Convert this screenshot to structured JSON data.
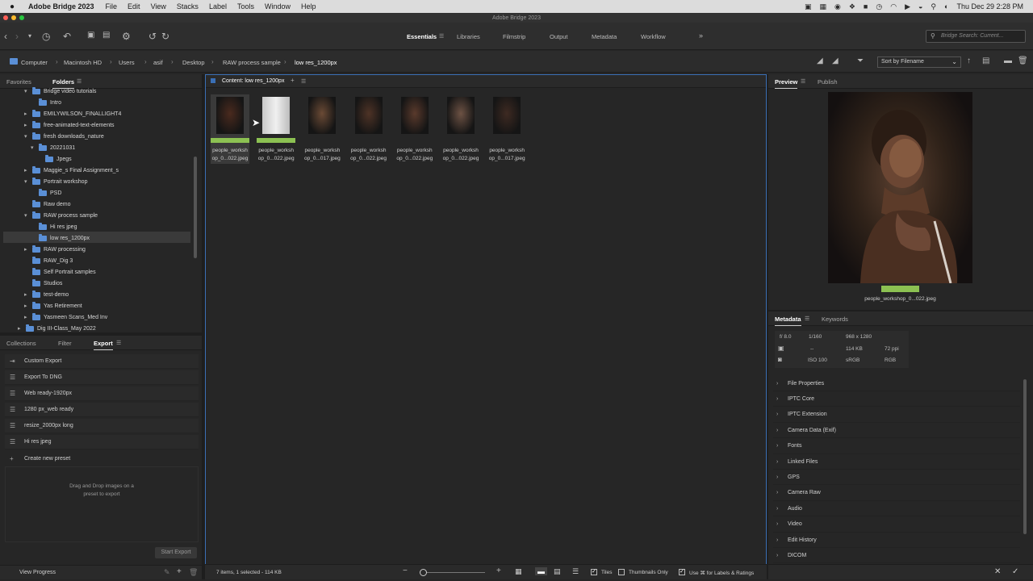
{
  "menubar": {
    "apple": "",
    "app": "Adobe Bridge 2023",
    "items": [
      "File",
      "Edit",
      "View",
      "Stacks",
      "Label",
      "Tools",
      "Window",
      "Help"
    ],
    "clock": "Thu Dec 29  2:28 PM"
  },
  "window": {
    "title": "Adobe Bridge 2023"
  },
  "workspaces": [
    "Essentials",
    "Libraries",
    "Filmstrip",
    "Output",
    "Metadata",
    "Workflow"
  ],
  "search": {
    "placeholder": "Bridge Search: Current..."
  },
  "breadcrumb": [
    "Computer",
    "Macintosh HD",
    "Users",
    "asif",
    "Desktop",
    "RAW process sample",
    "low res_1200px"
  ],
  "sort": {
    "label": "Sort by Filename"
  },
  "left_top_tabs": [
    "Favorites",
    "Folders"
  ],
  "tree": [
    {
      "label": "Bridge video tutorials",
      "indent": 2,
      "arrow": "open"
    },
    {
      "label": "Intro",
      "indent": 3,
      "arrow": ""
    },
    {
      "label": "EMILYWILSON_FINALLIGHT4",
      "indent": 2,
      "arrow": "closed"
    },
    {
      "label": "free-animated-text-elements",
      "indent": 2,
      "arrow": "closed"
    },
    {
      "label": "fresh downloads_nature",
      "indent": 2,
      "arrow": "open"
    },
    {
      "label": "20221031",
      "indent": 3,
      "arrow": "open"
    },
    {
      "label": "Jpegs",
      "indent": 4,
      "arrow": ""
    },
    {
      "label": "Maggie_s Final Assignment_s",
      "indent": 2,
      "arrow": "closed"
    },
    {
      "label": "Portrait workshop",
      "indent": 2,
      "arrow": "open"
    },
    {
      "label": "PSD",
      "indent": 3,
      "arrow": ""
    },
    {
      "label": "Raw demo",
      "indent": 2,
      "arrow": ""
    },
    {
      "label": "RAW process sample",
      "indent": 2,
      "arrow": "open"
    },
    {
      "label": "Hi res jpeg",
      "indent": 3,
      "arrow": ""
    },
    {
      "label": "low res_1200px",
      "indent": 3,
      "arrow": ""
    },
    {
      "label": "RAW processing",
      "indent": 2,
      "arrow": "closed"
    },
    {
      "label": "RAW_Dig 3",
      "indent": 2,
      "arrow": ""
    },
    {
      "label": "Self Portrait samples",
      "indent": 2,
      "arrow": ""
    },
    {
      "label": "Studios",
      "indent": 2,
      "arrow": ""
    },
    {
      "label": "test-demo",
      "indent": 2,
      "arrow": "closed"
    },
    {
      "label": "Yas Retirement",
      "indent": 2,
      "arrow": "closed"
    },
    {
      "label": "Yasmeen Scans_Med Inv",
      "indent": 2,
      "arrow": "closed"
    },
    {
      "label": "Dig III-Class_May 2022",
      "indent": 1,
      "arrow": "closed"
    }
  ],
  "left_bottom_tabs": [
    "Collections",
    "Filter",
    "Export"
  ],
  "export": {
    "presets": [
      "Custom Export",
      "Export To DNG",
      "Web ready-1920px",
      "1280 px_web ready",
      "resize_2000px long",
      "Hi res jpeg"
    ],
    "create": "Create new preset",
    "drop_hint_1": "Drag and Drop images on a",
    "drop_hint_2": "preset to export",
    "start": "Start Export",
    "progress": "View Progress"
  },
  "content": {
    "tab": "Content: low res_1200px",
    "thumbs": [
      {
        "line1": "people_worksh",
        "line2": "op_0...022.jpeg",
        "label_color": "#8cc152",
        "tone": "#4a2a1e"
      },
      {
        "line1": "people_worksh",
        "line2": "op_0...022.jpeg",
        "label_color": "#8cc152",
        "tone": "#d8d8d8"
      },
      {
        "line1": "people_worksh",
        "line2": "op_0...017.jpeg",
        "label_color": "",
        "tone": "#6a4a35"
      },
      {
        "line1": "people_worksh",
        "line2": "op_0...022.jpeg",
        "label_color": "",
        "tone": "#4e3326"
      },
      {
        "line1": "people_worksh",
        "line2": "op_0...022.jpeg",
        "label_color": "",
        "tone": "#5a3a2c"
      },
      {
        "line1": "people_worksh",
        "line2": "op_0...022.jpeg",
        "label_color": "",
        "tone": "#6d5244"
      },
      {
        "line1": "people_worksh",
        "line2": "op_0...017.jpeg",
        "label_color": "",
        "tone": "#3e2a22"
      }
    ],
    "status": "7 items, 1 selected - 114 KB",
    "view_opts": {
      "tiles": "Tiles",
      "thumbs_only": "Thumbnails Only",
      "use_for_labels": "Use ⌘ for Labels & Ratings"
    }
  },
  "right_top_tabs": [
    "Preview",
    "Publish"
  ],
  "preview": {
    "filename": "people_workshop_0...022.jpeg",
    "label_color": "#8cc152"
  },
  "right_mid_tabs": [
    "Metadata",
    "Keywords"
  ],
  "metadata": {
    "aperture": "f/ 8.0",
    "shutter": "1/160",
    "dims": "968 x 1280",
    "exposure": "--",
    "size": "114 KB",
    "ppi": "72 ppi",
    "iso": "ISO 100",
    "profile": "sRGB",
    "mode": "RGB"
  },
  "accordion": [
    "File Properties",
    "IPTC Core",
    "IPTC Extension",
    "Camera Data (Exif)",
    "Fonts",
    "Linked Files",
    "GPS",
    "Camera Raw",
    "Audio",
    "Video",
    "Edit History",
    "DICOM"
  ],
  "colors": {
    "accent_blue": "#3a6fb5",
    "label_green": "#8cc152",
    "folder_blue": "#5a8fd6"
  }
}
